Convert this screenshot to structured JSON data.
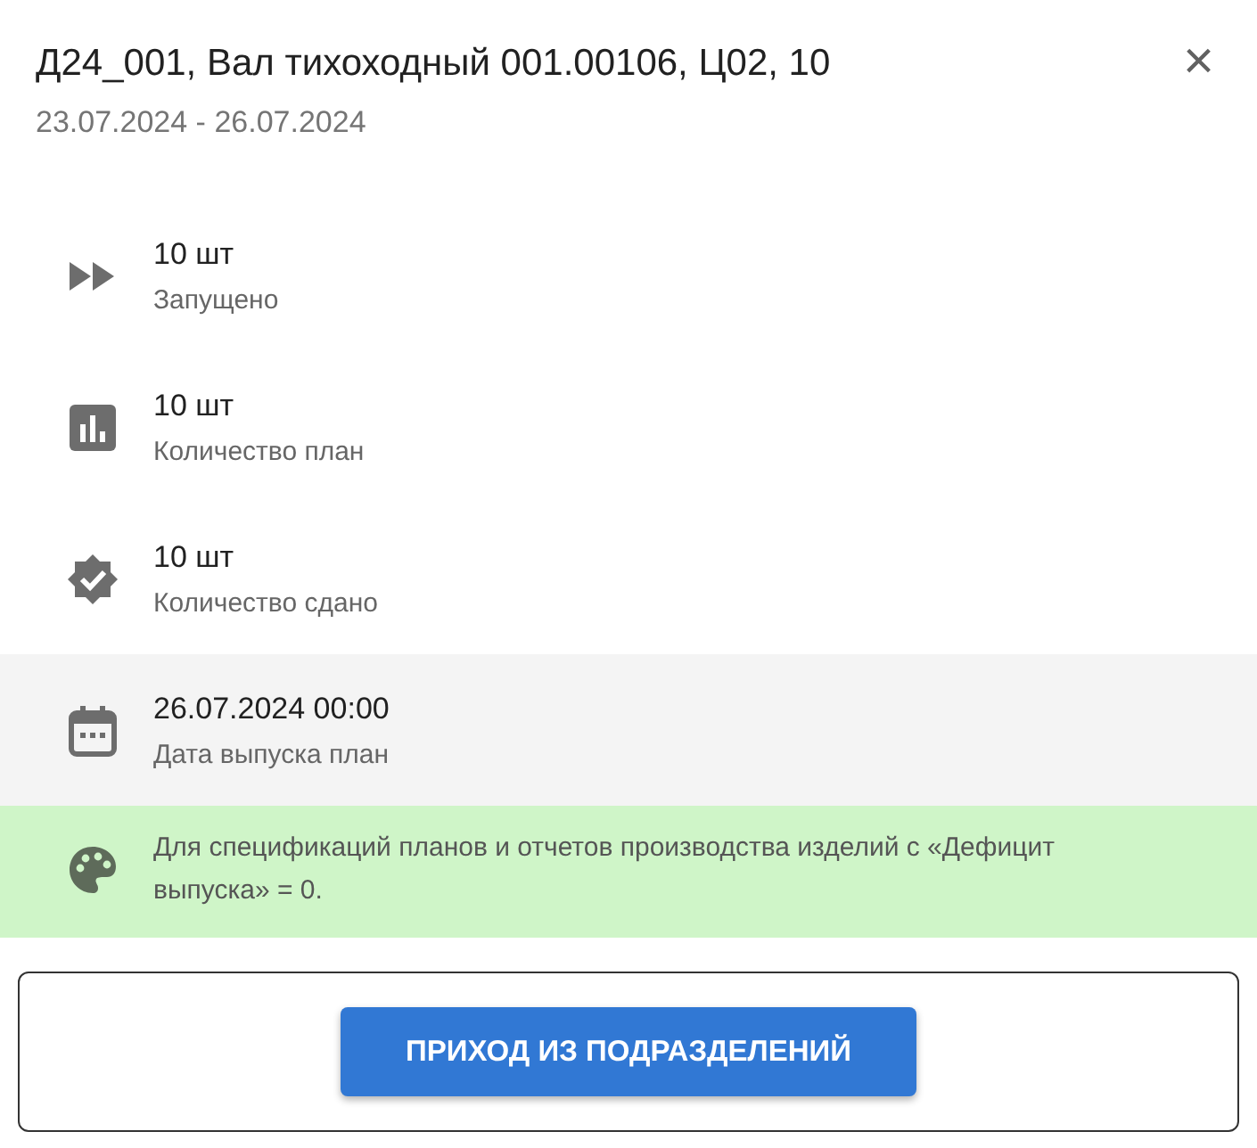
{
  "dialog": {
    "title": "Д24_001, Вал тихоходный 001.00106, Ц02, 10",
    "subtitle": "23.07.2024 - 26.07.2024",
    "close": "×"
  },
  "items": [
    {
      "kind": "launched",
      "value": "10 шт",
      "label": "Запущено"
    },
    {
      "kind": "plan",
      "value": "10 шт",
      "label": "Количество план"
    },
    {
      "kind": "done",
      "value": "10 шт",
      "label": "Количество сдано"
    }
  ],
  "highlighted_item": {
    "kind": "date",
    "value": "26.07.2024 00:00",
    "label": "Дата выпуска план"
  },
  "note": {
    "kind": "palette",
    "text": "Для спецификаций планов и отчетов производства изделий с «Дефицит выпуска» = 0."
  },
  "action_button": "ПРИХОД ИЗ ПОДРАЗДЕЛЕНИЙ"
}
